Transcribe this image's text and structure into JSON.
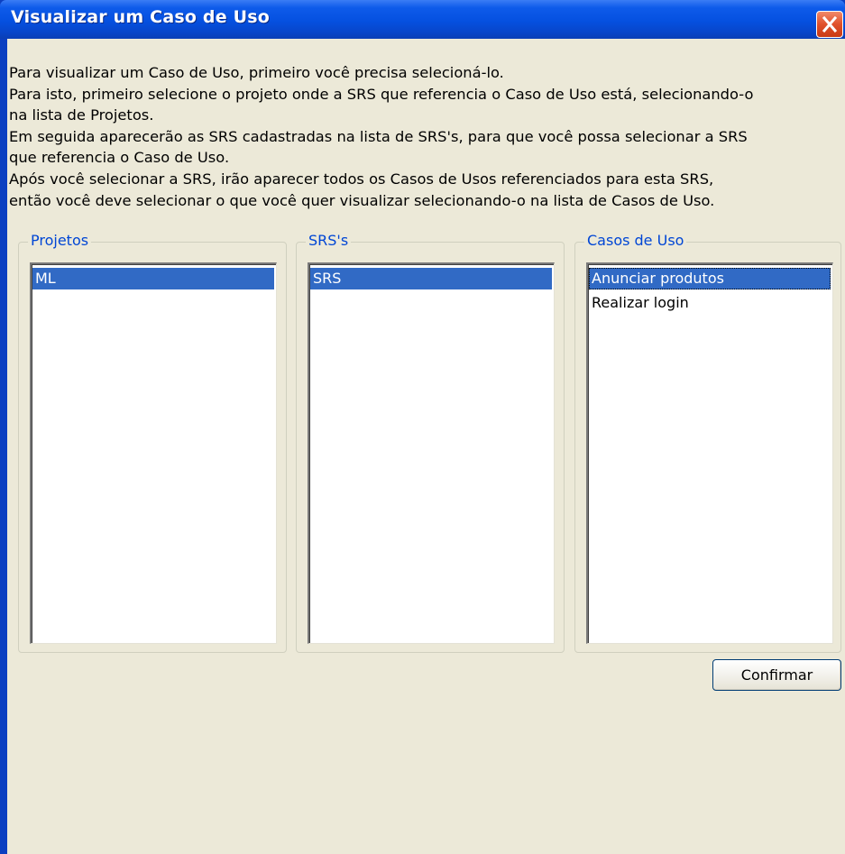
{
  "window": {
    "title": "Visualizar um Caso de Uso",
    "colors": {
      "titlebar": "#0550e0",
      "client": "#ece9d8",
      "group_label": "#0046d5",
      "selection": "#316ac5",
      "close_button": "#e0502a"
    }
  },
  "titlebar": {
    "close_icon": "close-x-icon"
  },
  "description": {
    "lines": [
      "Para visualizar um Caso de Uso, primeiro você precisa selecioná-lo.",
      "Para isto, primeiro selecione o projeto onde a SRS que referencia o Caso de Uso está, selecionando-o",
      "na lista de Projetos.",
      "Em seguida aparecerão as SRS cadastradas na lista de SRS's, para que você possa selecionar a SRS",
      "que referencia o Caso de Uso.",
      "Após você selecionar a SRS, irão aparecer todos os Casos de Usos referenciados para esta SRS,",
      "então você deve selecionar o que você quer visualizar selecionando-o na lista de Casos de Uso."
    ]
  },
  "groups": {
    "projetos": {
      "label": "Projetos",
      "items": [
        {
          "text": "ML",
          "selected": true
        }
      ]
    },
    "srs": {
      "label": "SRS's",
      "items": [
        {
          "text": "SRS",
          "selected": true
        }
      ]
    },
    "casos": {
      "label": "Casos de Uso",
      "items": [
        {
          "text": "Anunciar produtos",
          "selected": true,
          "focused": true
        },
        {
          "text": "Realizar login",
          "selected": false
        }
      ]
    }
  },
  "buttons": {
    "confirm_label": "Confirmar"
  }
}
